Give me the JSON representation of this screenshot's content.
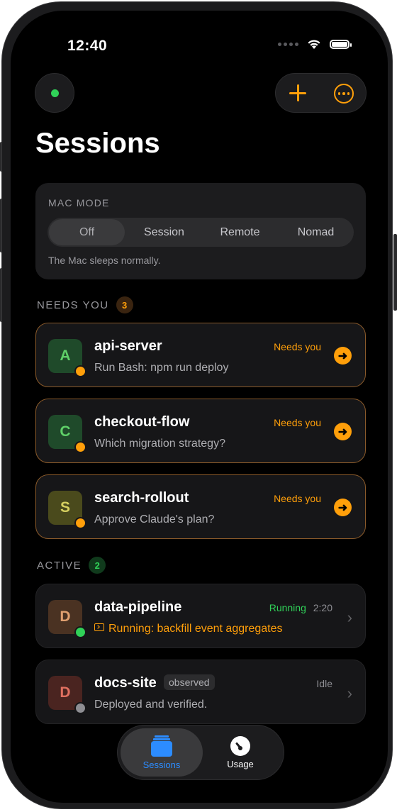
{
  "status": {
    "time": "12:40"
  },
  "header": {
    "title": "Sessions"
  },
  "mac_mode": {
    "label": "MAC MODE",
    "options": [
      "Off",
      "Session",
      "Remote",
      "Nomad"
    ],
    "selected": "Off",
    "note": "The Mac sleeps normally."
  },
  "needs_you": {
    "title": "NEEDS YOU",
    "count": "3",
    "items": [
      {
        "initial": "A",
        "name": "api-server",
        "status": "Needs you",
        "subtitle": "Run Bash: npm run deploy",
        "avatar_bg": "#1f4a2a",
        "avatar_fg": "#5fd068"
      },
      {
        "initial": "C",
        "name": "checkout-flow",
        "status": "Needs you",
        "subtitle": "Which migration strategy?",
        "avatar_bg": "#1f4a2a",
        "avatar_fg": "#5fd068"
      },
      {
        "initial": "S",
        "name": "search-rollout",
        "status": "Needs you",
        "subtitle": "Approve Claude's plan?",
        "avatar_bg": "#4a4a1c",
        "avatar_fg": "#d6d060"
      }
    ]
  },
  "active": {
    "title": "ACTIVE",
    "count": "2",
    "items": [
      {
        "initial": "D",
        "name": "data-pipeline",
        "status": "Running",
        "time": "2:20",
        "subtitle": "Running: backfill event aggregates",
        "avatar_bg": "#4a3222",
        "avatar_fg": "#e0a070"
      },
      {
        "initial": "D",
        "name": "docs-site",
        "badge": "observed",
        "status": "Idle",
        "subtitle": "Deployed and verified.",
        "avatar_bg": "#4a2420",
        "avatar_fg": "#e07060"
      }
    ]
  },
  "tabbar": {
    "sessions": "Sessions",
    "usage": "Usage"
  },
  "colors": {
    "accent": "#ff9f0a",
    "green": "#30d158",
    "blue": "#2c8cff"
  }
}
